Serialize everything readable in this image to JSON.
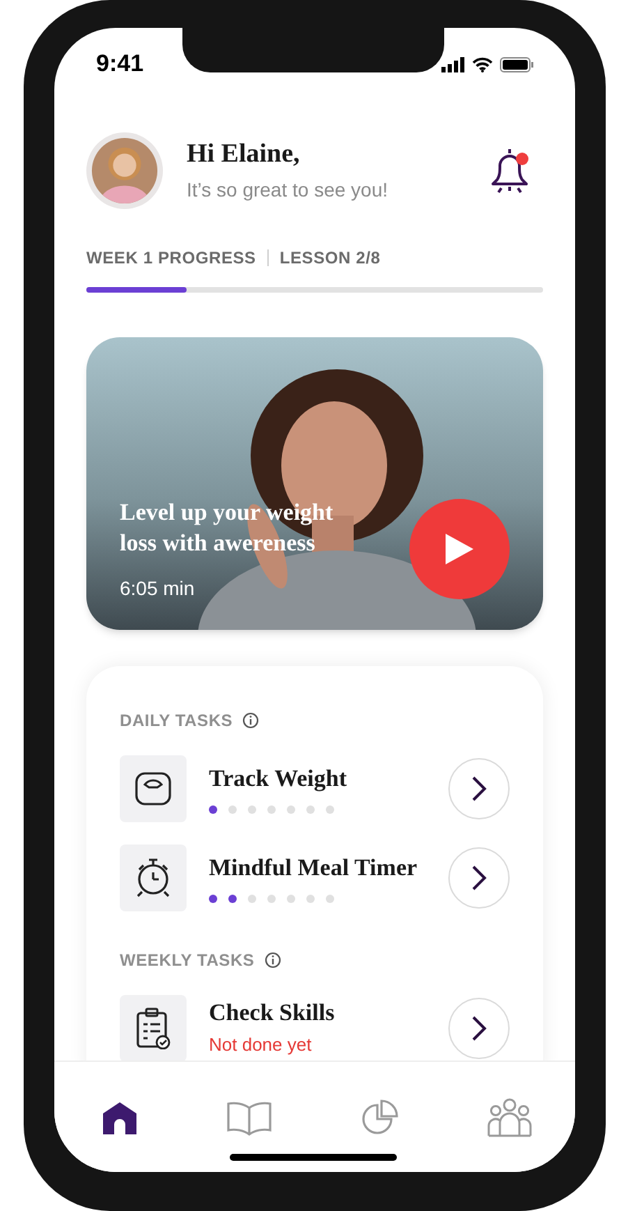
{
  "status_bar": {
    "time": "9:41"
  },
  "header": {
    "greeting": "Hi Elaine,",
    "subtitle": "It’s so great to see you!",
    "notification": true
  },
  "progress": {
    "week": "WEEK 1 PROGRESS",
    "lesson": "LESSON 2/8",
    "level": 0.22
  },
  "video": {
    "kind": "picture",
    "title": "Level up your weight loss with awereness",
    "duration": "6:05 min"
  },
  "sections": [
    {
      "title": "DAILY TASKS",
      "tasks": [
        {
          "kind": "scale",
          "title": "Track Weight",
          "dots": [
            {
              "filled": true
            },
            {
              "filled": false
            },
            {
              "filled": false
            },
            {
              "filled": false
            },
            {
              "filled": false
            },
            {
              "filled": false
            },
            {
              "filled": false
            }
          ]
        },
        {
          "kind": "timer",
          "title": "Mindful Meal Timer",
          "dots": [
            {
              "filled": true
            },
            {
              "filled": true
            },
            {
              "filled": false
            },
            {
              "filled": false
            },
            {
              "filled": false
            },
            {
              "filled": false
            },
            {
              "filled": false
            }
          ]
        }
      ]
    },
    {
      "title": "WEEKLY TASKS",
      "tasks": [
        {
          "kind": "clipboard",
          "title": "Check Skills",
          "status": "Not done yet"
        }
      ]
    }
  ],
  "nav": [
    {
      "kind": "home",
      "selected": true
    },
    {
      "kind": "book",
      "selected": false
    },
    {
      "kind": "chart",
      "selected": false
    },
    {
      "kind": "people",
      "selected": false
    }
  ]
}
